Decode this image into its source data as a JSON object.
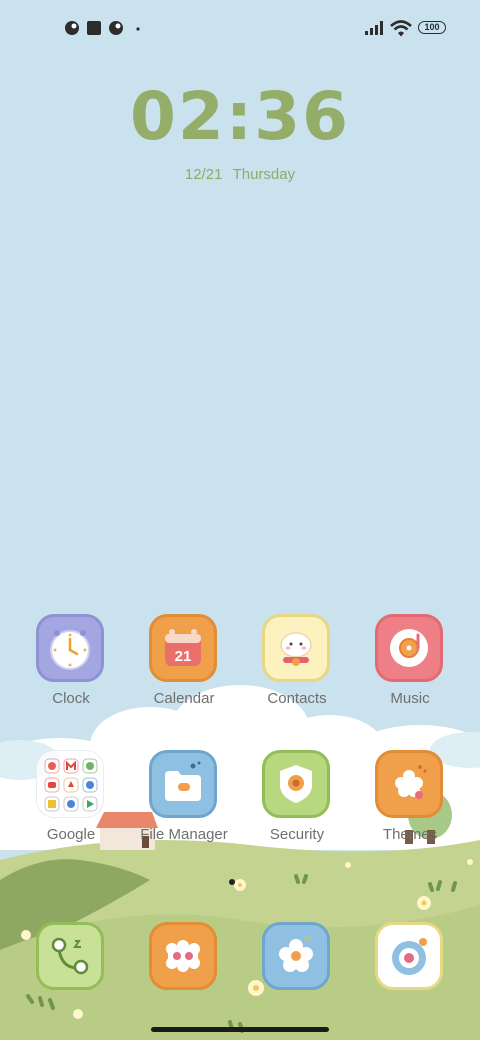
{
  "status_bar": {
    "left_icons": [
      "notification-app-icon",
      "notification-square-icon",
      "notification-app-icon",
      "more-dot-icon"
    ],
    "right_icons": [
      "signal-icon",
      "wifi-icon",
      "battery-icon"
    ],
    "battery_level": "100"
  },
  "lock_widget": {
    "time": "02:36",
    "date": "12/21",
    "weekday": "Thursday"
  },
  "home_apps": [
    {
      "label": "Clock",
      "icon": "clock-icon"
    },
    {
      "label": "Calendar",
      "icon": "calendar-icon",
      "badge": "21"
    },
    {
      "label": "Contacts",
      "icon": "contacts-icon"
    },
    {
      "label": "Music",
      "icon": "music-icon"
    },
    {
      "label": "Google",
      "icon": "google-folder-icon"
    },
    {
      "label": "File Manager",
      "icon": "file-manager-icon"
    },
    {
      "label": "Security",
      "icon": "security-icon"
    },
    {
      "label": "Themes",
      "icon": "themes-icon"
    }
  ],
  "dock_apps": [
    {
      "icon": "phone-icon"
    },
    {
      "icon": "messages-icon"
    },
    {
      "icon": "gallery-icon"
    },
    {
      "icon": "camera-icon"
    }
  ],
  "colors": {
    "sky": "#c9e2ee",
    "hill_light": "#c4d490",
    "hill_dark": "#8fa861",
    "clock_text": "#94ad68"
  }
}
